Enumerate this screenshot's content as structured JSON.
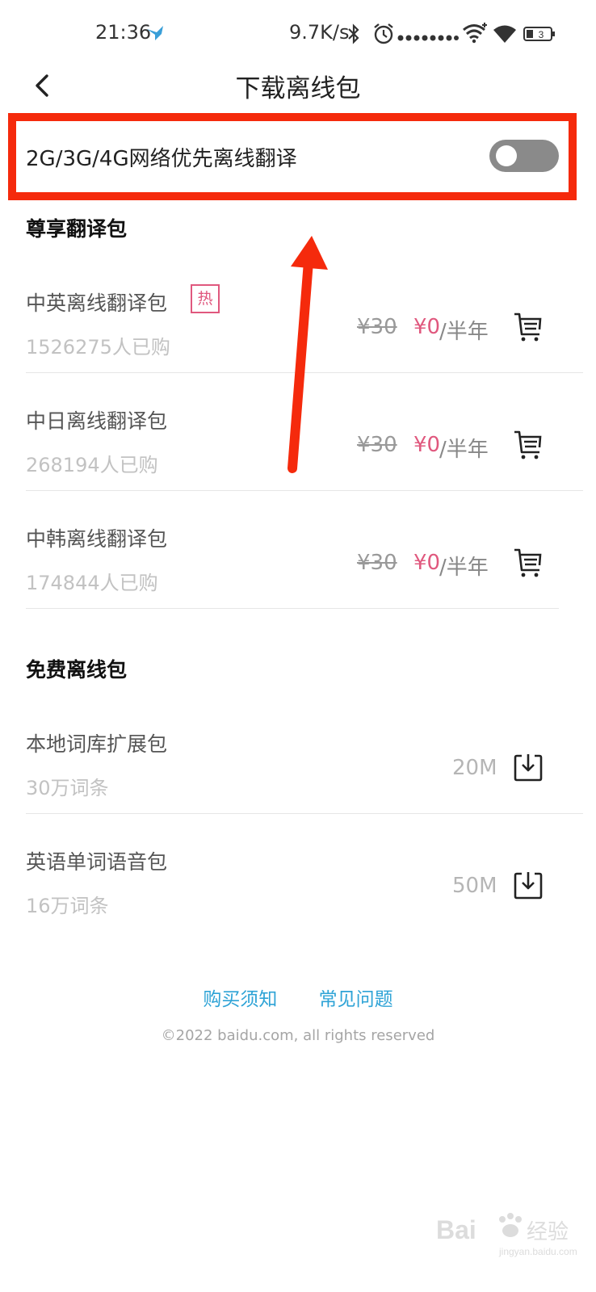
{
  "status_bar": {
    "time": "21:36",
    "speed": "9.7K/s",
    "battery": "3",
    "icons": [
      "plane-icon",
      "bluetooth-icon",
      "alarm-icon",
      "signal-dots-icon",
      "wifi-plus-icon",
      "wifi-icon",
      "battery-icon"
    ]
  },
  "nav": {
    "title": "下载离线包",
    "back_icon": "chevron-left-icon"
  },
  "toggle": {
    "label": "2G/3G/4G网络优先离线翻译",
    "state": "off"
  },
  "premium_section": {
    "title": "尊享翻译包",
    "items": [
      {
        "name": "中英离线翻译包",
        "badge": "热",
        "buyers": "1526275人已购",
        "old_price": "¥30",
        "new_price": "¥0",
        "period": "/半年",
        "action_icon": "cart-icon"
      },
      {
        "name": "中日离线翻译包",
        "buyers": "268194人已购",
        "old_price": "¥30",
        "new_price": "¥0",
        "period": "/半年",
        "action_icon": "cart-icon"
      },
      {
        "name": "中韩离线翻译包",
        "buyers": "174844人已购",
        "old_price": "¥30",
        "new_price": "¥0",
        "period": "/半年",
        "action_icon": "cart-icon"
      }
    ]
  },
  "free_section": {
    "title": "免费离线包",
    "items": [
      {
        "name": "本地词库扩展包",
        "sub": "30万词条",
        "size": "20M",
        "action_icon": "download-icon"
      },
      {
        "name": "英语单词语音包",
        "sub": "16万词条",
        "size": "50M",
        "action_icon": "download-icon"
      }
    ]
  },
  "footer": {
    "link_purchase": "购买须知",
    "link_faq": "常见问题",
    "copyright": "©2022 baidu.com, all rights reserved"
  },
  "watermark": {
    "text": "Baidu经验",
    "sub": "jingyan.baidu.com"
  },
  "colors": {
    "highlight_red": "#f52a0c",
    "price_pink": "#e0587e",
    "link_blue": "#2ea3d6",
    "toggle_off_gray": "#8a8a8a"
  }
}
